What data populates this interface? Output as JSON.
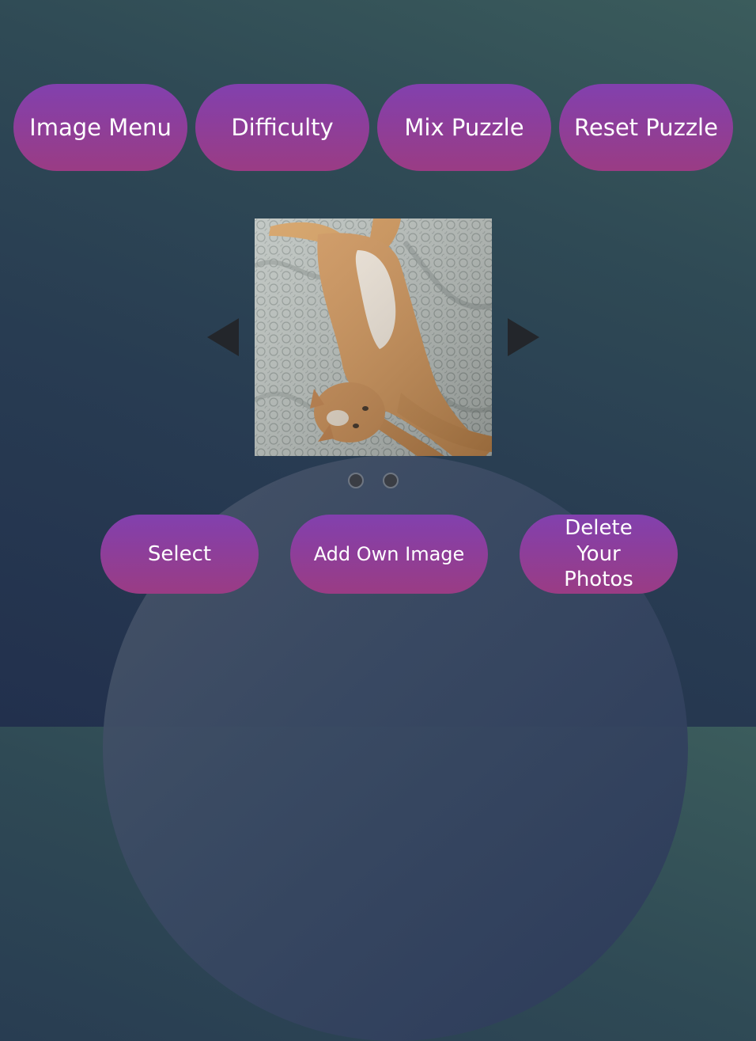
{
  "toolbar": {
    "image_menu_label": "Image Menu",
    "difficulty_label": "Difficulty",
    "mix_puzzle_label": "Mix Puzzle",
    "reset_puzzle_label": "Reset Puzzle"
  },
  "carousel": {
    "prev_icon": "triangle-left",
    "next_icon": "triangle-right",
    "image_subject": "orange tabby cat stretched on patterned bed sheet",
    "indicator_count": 2,
    "active_indicator": 0
  },
  "actions": {
    "select_label": "Select",
    "add_own_image_label": "Add Own Image",
    "delete_photos_label": "Delete Your Photos"
  },
  "colors": {
    "button_top": "#8240ae",
    "button_bottom": "#9a3c84",
    "background_top": "#3b5c5c",
    "background_bottom": "#22304d"
  }
}
